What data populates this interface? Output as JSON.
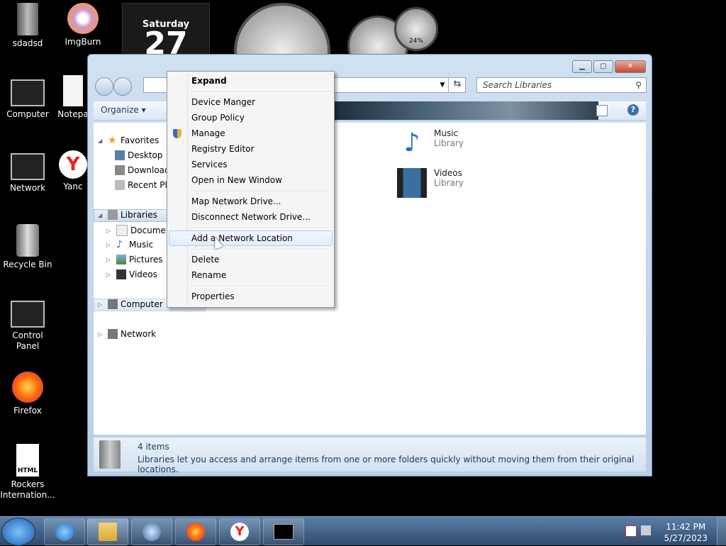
{
  "desktop": {
    "icons": [
      {
        "label": "sdadsd"
      },
      {
        "label": "ImgBurn"
      },
      {
        "label": "Computer"
      },
      {
        "label": "Notepa"
      },
      {
        "label": "Network"
      },
      {
        "label": "Yanc"
      },
      {
        "label": "Recycle Bin"
      },
      {
        "label": "Control Panel"
      },
      {
        "label": "Firefox"
      },
      {
        "label": "Rockers Internation..."
      }
    ]
  },
  "gadgets": {
    "calendar_day": "Saturday",
    "calendar_date": "27",
    "gauge_value": "24%"
  },
  "explorer": {
    "search_placeholder": "Search Libraries",
    "organize_label": "Organize",
    "nav": {
      "favorites": "Favorites",
      "desktop": "Desktop",
      "downloads": "Download",
      "recent": "Recent Pla",
      "libraries": "Libraries",
      "documents": "Document",
      "music": "Music",
      "pictures": "Pictures",
      "videos": "Videos",
      "computer": "Computer",
      "network": "Network"
    },
    "content": [
      {
        "name": "Music",
        "sub": "Library"
      },
      {
        "name": "Videos",
        "sub": "Library"
      }
    ],
    "status": {
      "count": "4 items",
      "description": "Libraries let you access and arrange items from one or more folders quickly without moving them from their original locations."
    }
  },
  "context_menu": {
    "items": [
      "Expand",
      "Device Manger",
      "Group Policy",
      "Manage",
      "Registry Editor",
      "Services",
      "Open in New Window",
      "Map Network Drive...",
      "Disconnect Network Drive...",
      "Add a Network Location",
      "Delete",
      "Rename",
      "Properties"
    ],
    "hovered": "Add a Network Location"
  },
  "taskbar": {
    "time": "11:42 PM",
    "date": "5/27/2023"
  },
  "colors": {
    "accent": "#3d6fb0",
    "taskbar": "#2f4a6c"
  }
}
